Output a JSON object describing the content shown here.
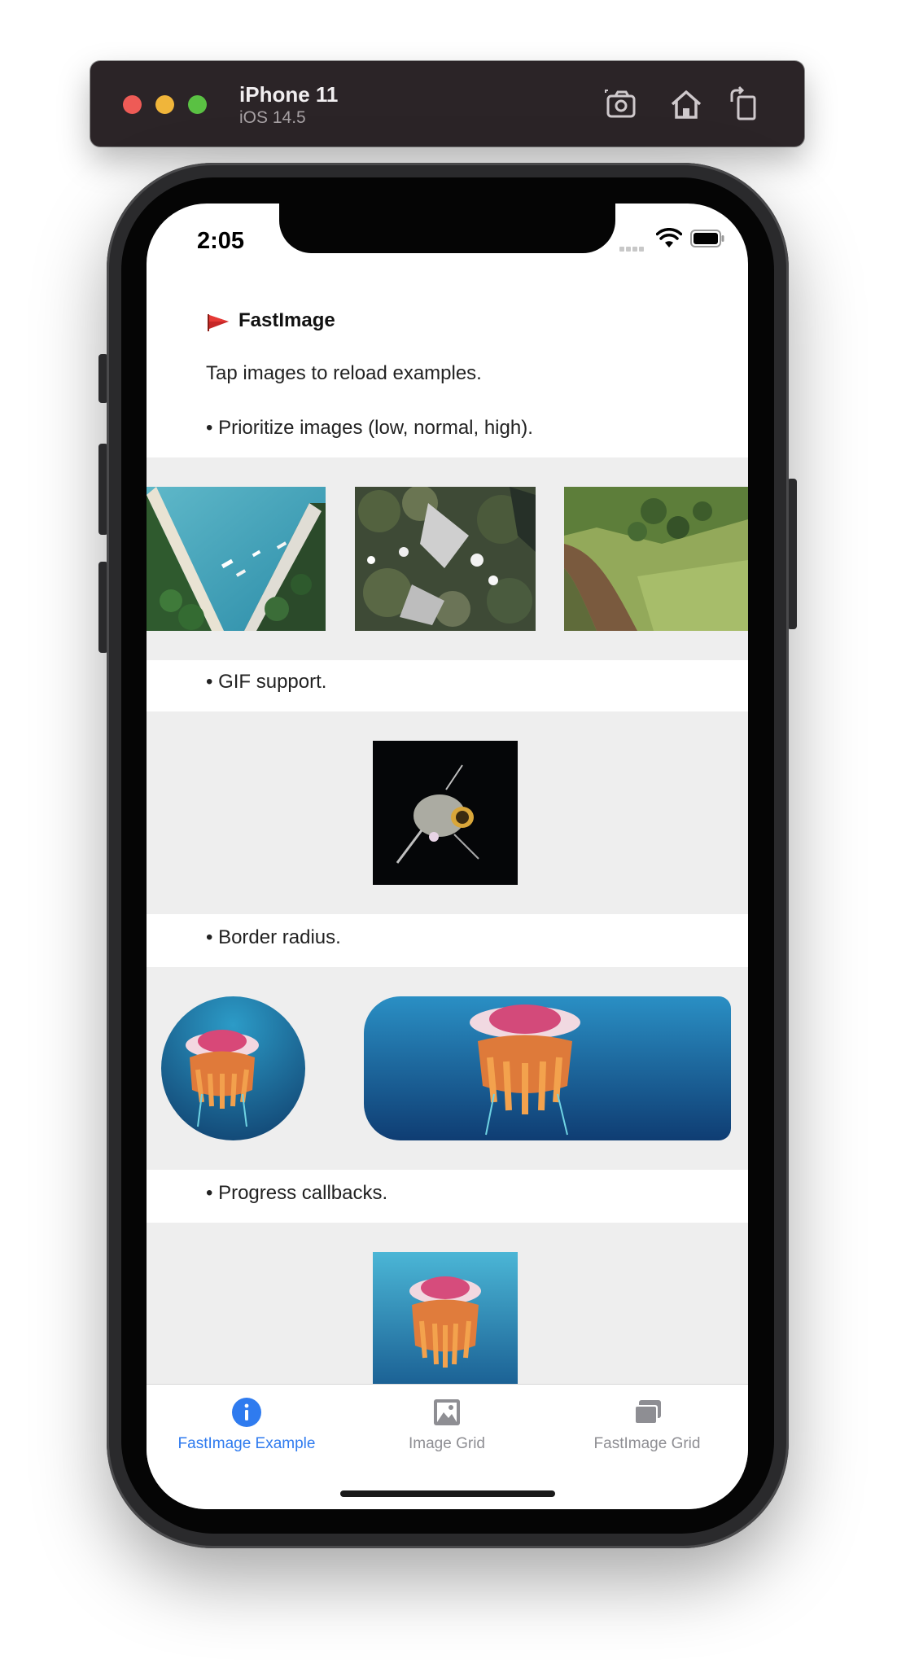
{
  "simulator": {
    "device_name": "iPhone 11",
    "os_version": "iOS 14.5",
    "buttons": [
      "screenshot-icon",
      "home-icon",
      "rotate-icon"
    ]
  },
  "status_bar": {
    "time": "2:05"
  },
  "app": {
    "title": "FastImage",
    "intro": "Tap images to reload examples.",
    "sections": {
      "priority": "• Prioritize images (low, normal, high).",
      "gif": "• GIF support.",
      "radius": "• Border radius.",
      "progress": "• Progress callbacks."
    }
  },
  "tabbar": {
    "tabs": [
      {
        "label": "FastImage Example",
        "icon": "info-icon",
        "active": true
      },
      {
        "label": "Image Grid",
        "icon": "image-icon",
        "active": false
      },
      {
        "label": "FastImage Grid",
        "icon": "images-stack-icon",
        "active": false
      }
    ]
  },
  "colors": {
    "accent": "#2f7bef",
    "band_background": "#eeeeee",
    "inactive_tab": "#8e8e93"
  }
}
